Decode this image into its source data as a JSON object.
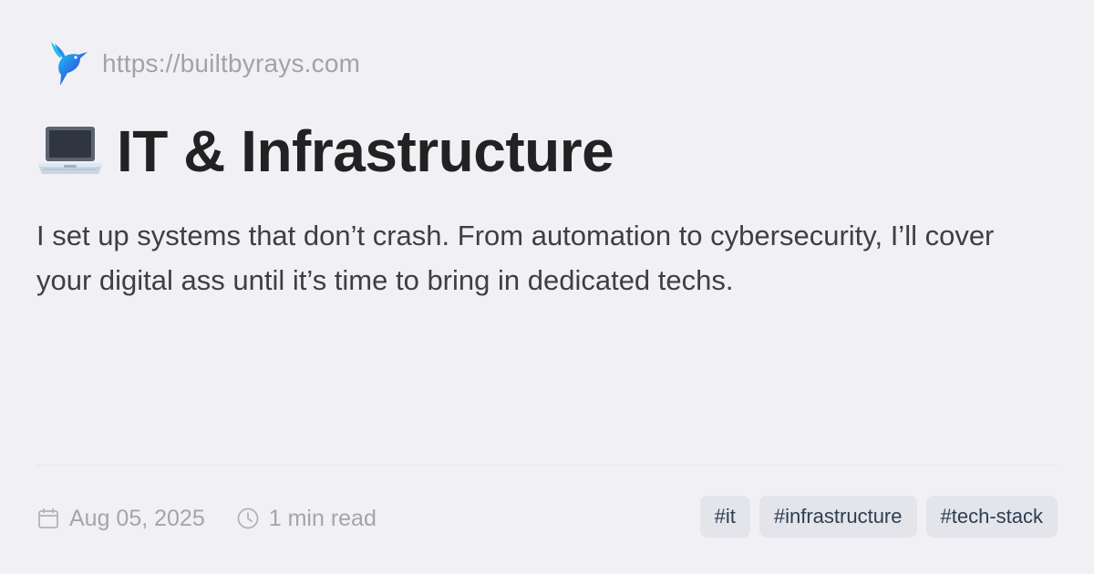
{
  "header": {
    "logo_icon": "hummingbird-icon",
    "site_url": "https://builtbyrays.com"
  },
  "main": {
    "title_icon": "laptop-icon",
    "title": "IT & Infrastructure",
    "description": "I set up systems that don’t crash. From automation to cybersecurity, I’ll cover your digital ass until it’s time to bring in dedicated techs."
  },
  "meta": {
    "date_icon": "calendar-icon",
    "date": "Aug 05, 2025",
    "read_icon": "clock-icon",
    "read_time": "1 min read"
  },
  "tags": [
    "#it",
    "#infrastructure",
    "#tech-stack"
  ],
  "colors": {
    "background": "#f1f1f5",
    "title": "#222222",
    "muted": "#a2a2a8",
    "tag_background": "#e3e5ea",
    "tag_text": "#2f3d52"
  }
}
